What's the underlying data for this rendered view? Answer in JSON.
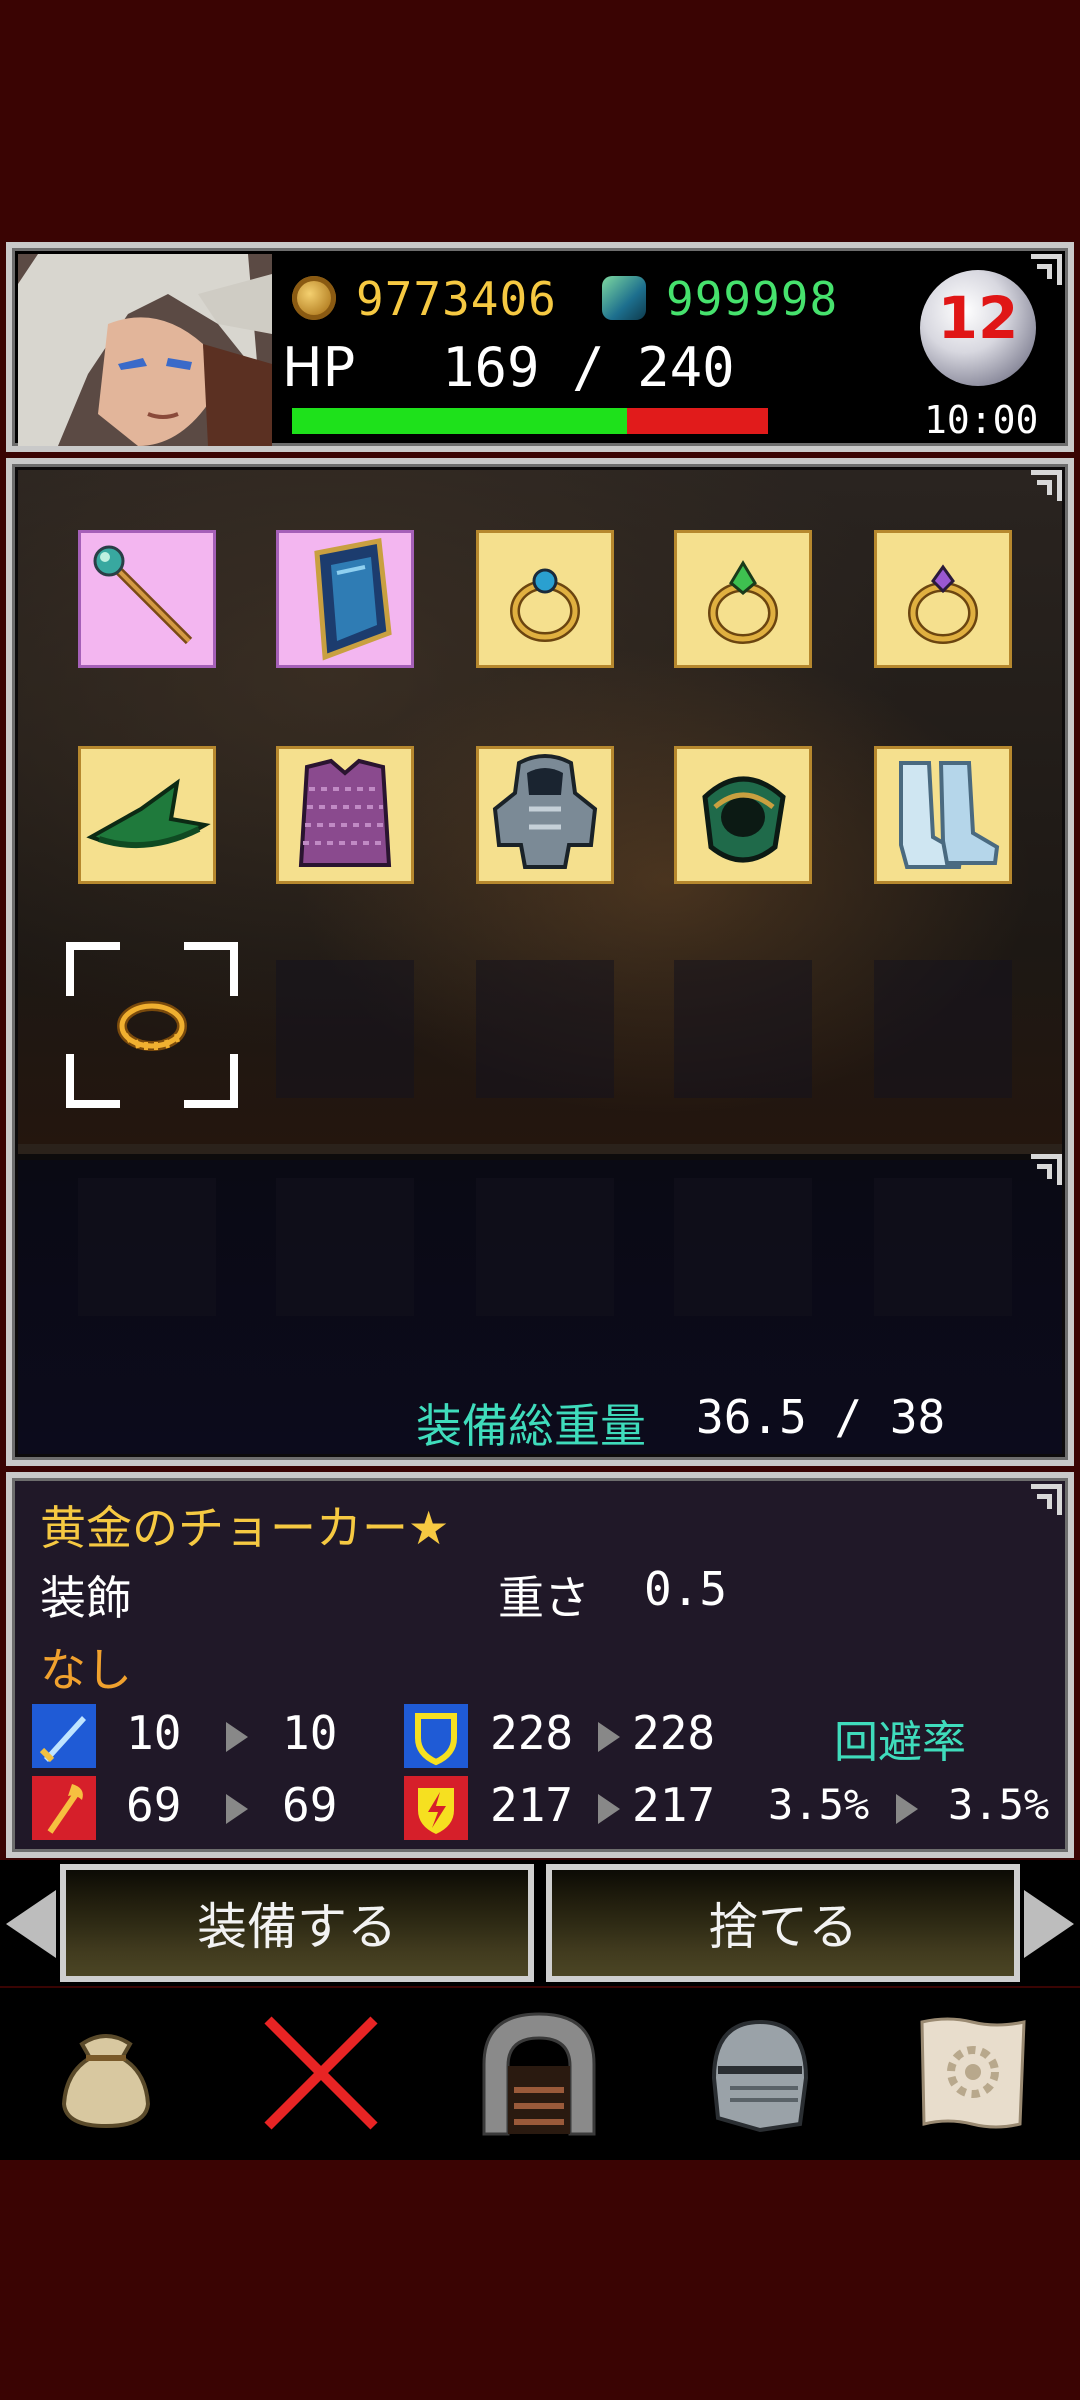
{
  "header": {
    "gold": "9773406",
    "gems": "999998",
    "hp_label": "HP",
    "hp": "169 / 240",
    "hp_ratio": 0.704,
    "floor": "12",
    "clock": "10:00"
  },
  "equipment": {
    "slots": [
      {
        "item": "staff-icon",
        "rarity": "rare"
      },
      {
        "item": "shield-icon",
        "rarity": "rare"
      },
      {
        "item": "ring-blue-gem-icon",
        "rarity": "normal"
      },
      {
        "item": "ring-green-gem-icon",
        "rarity": "normal"
      },
      {
        "item": "ring-purple-gem-icon",
        "rarity": "normal"
      },
      {
        "item": "wizard-hat-icon",
        "rarity": "normal"
      },
      {
        "item": "chainmail-icon",
        "rarity": "normal"
      },
      {
        "item": "plate-armor-icon",
        "rarity": "normal"
      },
      {
        "item": "bracer-icon",
        "rarity": "normal"
      },
      {
        "item": "boots-icon",
        "rarity": "normal"
      }
    ],
    "selected_item": "gold-choker-icon",
    "weight_label": "装備総重量",
    "weight": "36.5 / 38"
  },
  "item": {
    "name": "黄金のチョーカー★",
    "category": "装飾",
    "weight_label": "重さ",
    "weight": "0.5",
    "effect": "なし",
    "stats": {
      "attack": {
        "icon": "sword-icon",
        "from": "10",
        "to": "10",
        "color": "#1f5bd6"
      },
      "magic": {
        "icon": "wand-icon",
        "from": "69",
        "to": "69",
        "color": "#d61f2a"
      },
      "defense": {
        "icon": "shield-stat-icon",
        "from": "228",
        "to": "228",
        "color": "#1f5bd6"
      },
      "resist": {
        "icon": "lightning-icon",
        "from": "217",
        "to": "217",
        "color": "#d61f2a"
      },
      "evasion_label": "回避率",
      "evasion_from": "3.5%",
      "evasion_to": "3.5%"
    }
  },
  "actions": {
    "equip": "装備する",
    "discard": "捨てる"
  },
  "nav": [
    "bag-icon",
    "close-icon",
    "dungeon-door-icon",
    "helmet-icon",
    "map-icon"
  ],
  "colors": {
    "gold": "#f6c942",
    "gem": "#46e26d",
    "accent": "#3fdcbc",
    "hp_green": "#1ee11b",
    "hp_red": "#e11b1b"
  }
}
